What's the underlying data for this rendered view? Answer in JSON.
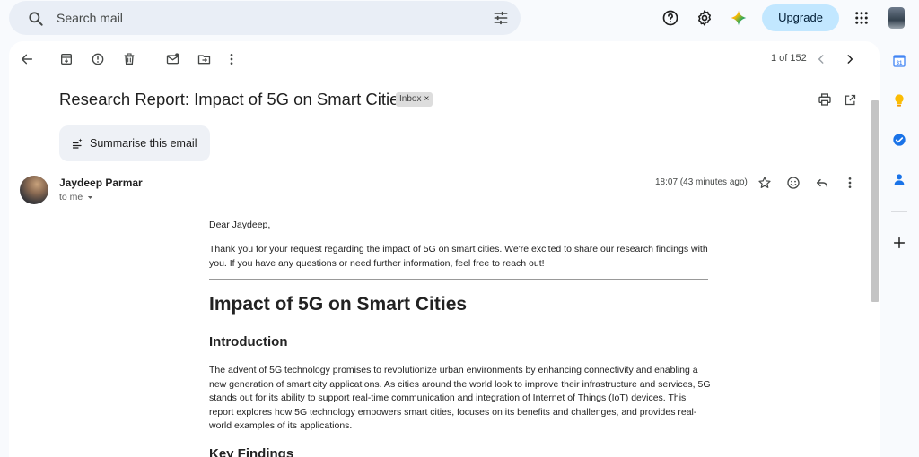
{
  "search": {
    "placeholder": "Search mail"
  },
  "header": {
    "upgrade_label": "Upgrade"
  },
  "toolbar": {
    "pager": "1 of 152"
  },
  "email": {
    "subject": "Research Report: Impact of 5G on Smart Cities",
    "label": "Inbox",
    "label_close": "×",
    "summarise_label": "Summarise this email",
    "sender": "Jaydeep Parmar",
    "recipient": "to me",
    "time": "18:07 (43 minutes ago)",
    "greeting": "Dear Jaydeep,",
    "intro_paragraph": "Thank you for your request regarding the impact of 5G on smart cities. We're excited to share our research findings with you. If you have any questions or need further information, feel free to reach out!",
    "heading": "Impact of 5G on Smart Cities",
    "section1_title": "Introduction",
    "section1_text": "The advent of 5G technology promises to revolutionize urban environments by enhancing connectivity and enabling a new generation of smart city applications. As cities around the world look to improve their infrastructure and services, 5G stands out for its ability to support real-time communication and integration of Internet of Things (IoT) devices. This report explores how 5G technology empowers smart cities, focuses on its benefits and challenges, and provides real-world examples of its applications.",
    "section2_title": "Key Findings"
  },
  "rail": {
    "calendar_day": "31"
  },
  "colors": {
    "accent": "#c2e7ff",
    "calendar": "#4285f4",
    "keep": "#fbbc04",
    "tasks": "#1a73e8",
    "contacts": "#1a73e8"
  }
}
